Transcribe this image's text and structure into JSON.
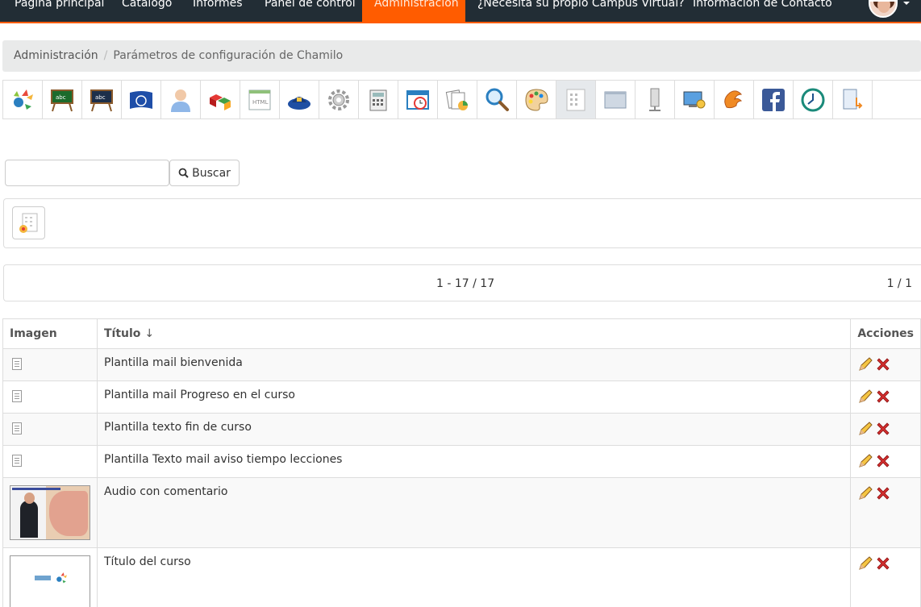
{
  "navbar": {
    "items": [
      {
        "label": "Página principal"
      },
      {
        "label": "Catálogo"
      },
      {
        "label": "Informes"
      },
      {
        "label": "Panel de control"
      },
      {
        "label": "Administración",
        "active": true
      },
      {
        "label": "¿Necesita su propio Campus Virtual?"
      },
      {
        "label": "Información de Contacto"
      }
    ],
    "accent_color": "#ff5c00",
    "background_color": "#222d35"
  },
  "breadcrumb": {
    "items": [
      "Administración",
      "Parámetros de configuración de Chamilo"
    ],
    "separator": "/"
  },
  "toolbar": {
    "icons": [
      "chamilo-logo-icon",
      "course-blackboard-icon",
      "course-blackboard-dark-icon",
      "un-flag-icon",
      "user-icon",
      "blocks-icon",
      "html-editor-icon",
      "security-icon",
      "gear-icon",
      "calculator-icon",
      "calendar-clock-icon",
      "documents-icon",
      "search-icon",
      "palette-icon",
      "templates-icon",
      "window-icon",
      "server-icon",
      "monitor-lock-icon",
      "chat-icon",
      "facebook-icon",
      "clock-icon",
      "file-download-icon"
    ],
    "active_index": 14
  },
  "search": {
    "value": "",
    "button_label": "Buscar"
  },
  "actions": {
    "add_icon": "add-template-icon"
  },
  "pager": {
    "range": "1 - 17 / 17",
    "pages": "1 / 1"
  },
  "table": {
    "headers": {
      "image": "Imagen",
      "title": "Título",
      "sort_arrow": "↓",
      "actions": "Acciones"
    },
    "rows": [
      {
        "image": "document-icon",
        "title": "Plantilla mail bienvenida"
      },
      {
        "image": "document-icon",
        "title": "Plantilla mail Progreso en el curso"
      },
      {
        "image": "document-icon",
        "title": "Plantilla texto fin de curso"
      },
      {
        "image": "document-icon",
        "title": "Plantilla Texto mail aviso tiempo lecciones"
      },
      {
        "image": "thumbnail",
        "title": "Audio con comentario"
      },
      {
        "image": "thumbnail",
        "title": "Título del curso"
      }
    ]
  }
}
